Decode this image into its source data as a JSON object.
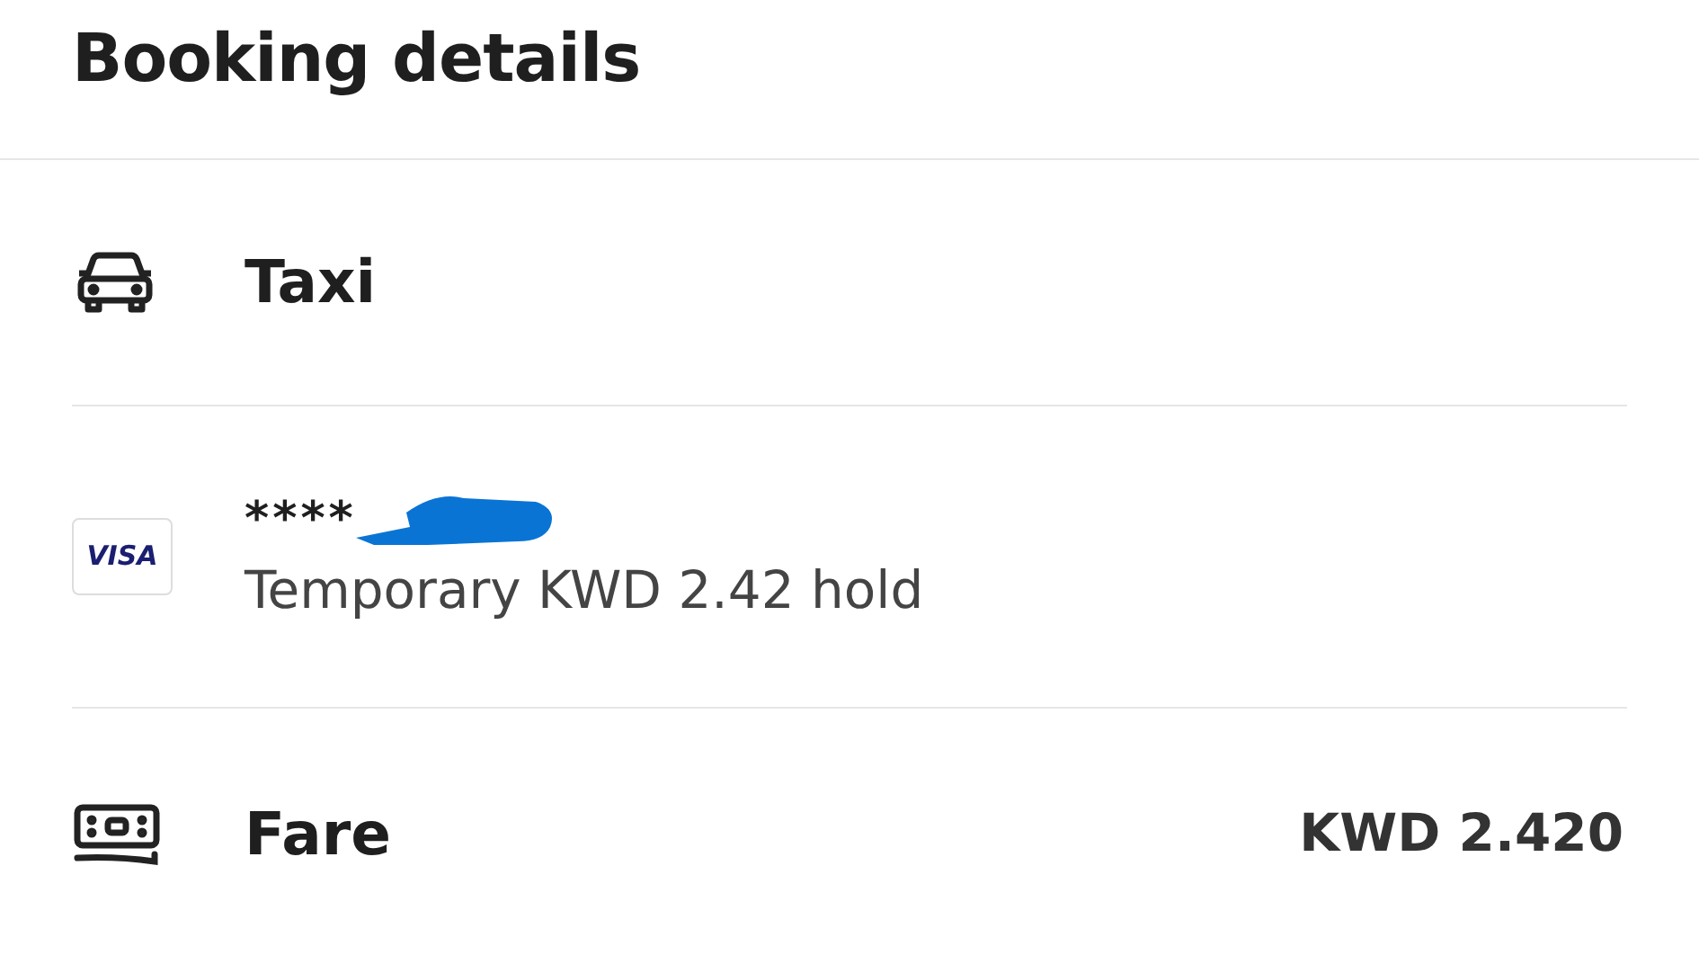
{
  "title": "Booking details",
  "rows": [
    {
      "kind": "service",
      "label": "Taxi"
    },
    {
      "kind": "payment",
      "brand": "VISA",
      "card": "****",
      "note": "Temporary KWD 2.42 hold"
    },
    {
      "kind": "fare",
      "label": "Fare",
      "amount": "KWD 2.420"
    }
  ]
}
